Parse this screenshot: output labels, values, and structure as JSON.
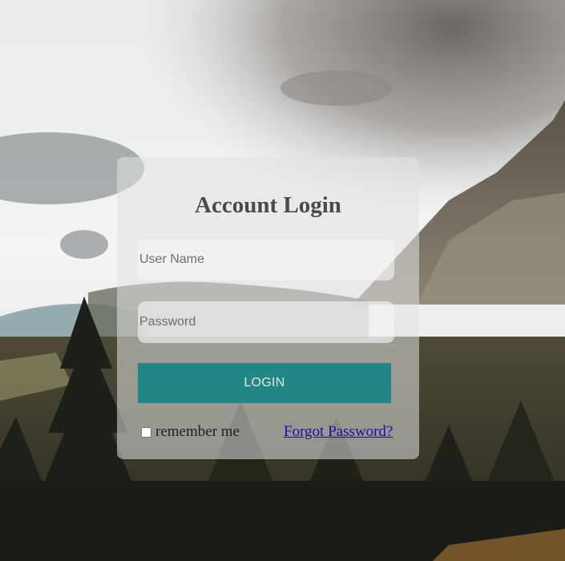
{
  "login_card": {
    "title": "Account Login",
    "username_placeholder": "User Name",
    "password_placeholder": "Password",
    "login_button_label": "LOGIN",
    "remember_label": "remember me",
    "forgot_link_label": "Forgot Password?"
  },
  "colors": {
    "login_button": "#008080",
    "title_text": "#4a4a4a",
    "link": "#1a0dab"
  }
}
